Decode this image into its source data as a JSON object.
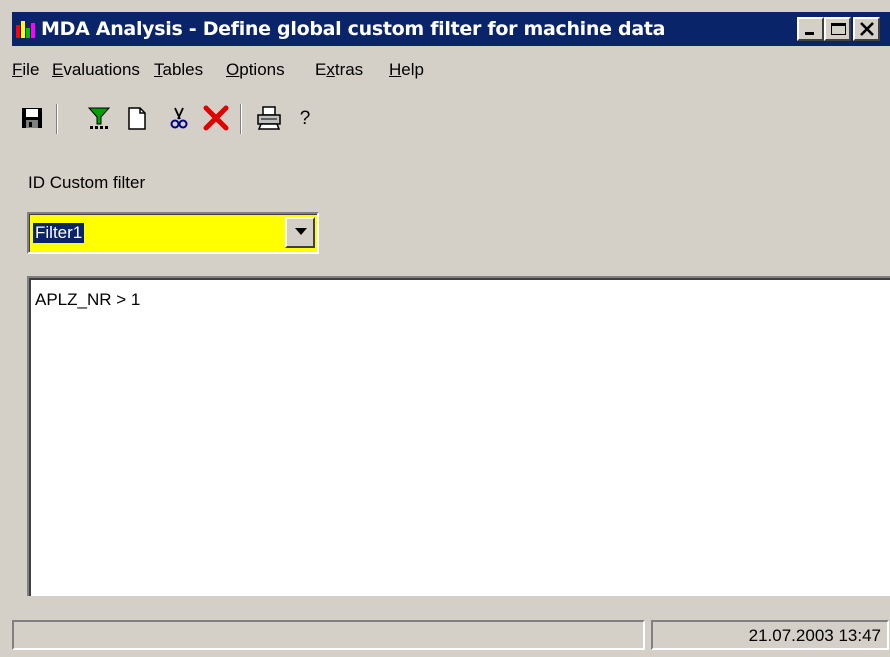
{
  "window": {
    "title": "MDA Analysis - Define global custom filter for machine data",
    "controls": [
      "minimize-icon",
      "maximize-icon",
      "close-icon"
    ]
  },
  "menu": {
    "items": [
      {
        "label": "File",
        "mnemonic": "F"
      },
      {
        "label": "Evaluations",
        "mnemonic": "E"
      },
      {
        "label": "Tables",
        "mnemonic": "T"
      },
      {
        "label": "Options",
        "mnemonic": "O"
      },
      {
        "label": "Extras",
        "mnemonic": "x"
      },
      {
        "label": "Help",
        "mnemonic": "H"
      }
    ]
  },
  "toolbar": {
    "icons": [
      "save-icon",
      "filter-icon",
      "new-document-icon",
      "cut-icon",
      "delete-icon",
      "print-icon",
      "help-icon"
    ],
    "help_glyph": "?"
  },
  "filter": {
    "label": "ID Custom filter",
    "selected": "Filter1",
    "highlight_color": "#ffff00",
    "expression": "APLZ_NR > 1"
  },
  "status": {
    "left_text": "",
    "datetime": "21.07.2003 13:47"
  },
  "colors": {
    "titlebar": "#0a246a",
    "face": "#d4d0c8",
    "delete": "#e00000"
  }
}
